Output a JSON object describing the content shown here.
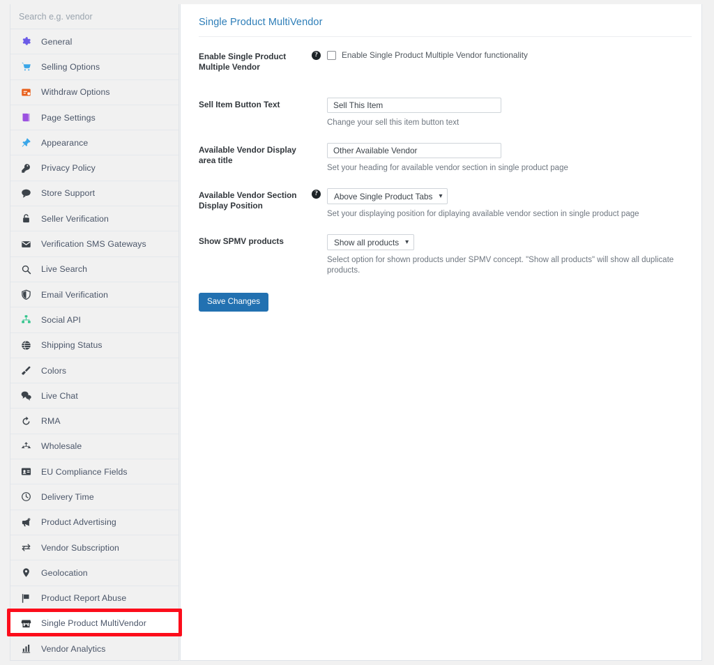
{
  "search": {
    "placeholder": "Search e.g. vendor",
    "value": ""
  },
  "sidebar": {
    "items": [
      {
        "label": "General",
        "icon": "gear-icon",
        "active": false
      },
      {
        "label": "Selling Options",
        "icon": "cart-icon",
        "active": false
      },
      {
        "label": "Withdraw Options",
        "icon": "withdraw-icon",
        "active": false
      },
      {
        "label": "Page Settings",
        "icon": "book-icon",
        "active": false
      },
      {
        "label": "Appearance",
        "icon": "pin-icon",
        "active": false
      },
      {
        "label": "Privacy Policy",
        "icon": "key-icon",
        "active": false
      },
      {
        "label": "Store Support",
        "icon": "chat-bubble-icon",
        "active": false
      },
      {
        "label": "Seller Verification",
        "icon": "lock-icon",
        "active": false
      },
      {
        "label": "Verification SMS Gateways",
        "icon": "envelope-icon",
        "active": false
      },
      {
        "label": "Live Search",
        "icon": "magnifier-icon",
        "active": false
      },
      {
        "label": "Email Verification",
        "icon": "shield-icon",
        "active": false
      },
      {
        "label": "Social API",
        "icon": "sitemap-icon",
        "active": false
      },
      {
        "label": "Shipping Status",
        "icon": "globe-icon",
        "active": false
      },
      {
        "label": "Colors",
        "icon": "paintbrush-icon",
        "active": false
      },
      {
        "label": "Live Chat",
        "icon": "chat-dots-icon",
        "active": false
      },
      {
        "label": "RMA",
        "icon": "undo-arrow-icon",
        "active": false
      },
      {
        "label": "Wholesale",
        "icon": "hierarchy-icon",
        "active": false
      },
      {
        "label": "EU Compliance Fields",
        "icon": "id-card-icon",
        "active": false
      },
      {
        "label": "Delivery Time",
        "icon": "clock-icon",
        "active": false
      },
      {
        "label": "Product Advertising",
        "icon": "megaphone-icon",
        "active": false
      },
      {
        "label": "Vendor Subscription",
        "icon": "exchange-icon",
        "active": false
      },
      {
        "label": "Geolocation",
        "icon": "map-marker-icon",
        "active": false
      },
      {
        "label": "Product Report Abuse",
        "icon": "flag-icon",
        "active": false
      },
      {
        "label": "Single Product MultiVendor",
        "icon": "store-icon",
        "active": true
      },
      {
        "label": "Vendor Analytics",
        "icon": "bar-chart-icon",
        "active": false
      }
    ]
  },
  "content": {
    "title": "Single Product MultiVendor",
    "fields": {
      "enable_spmv": {
        "label": "Enable Single Product Multiple Vendor",
        "checkbox_label": "Enable Single Product Multiple Vendor functionality",
        "checked": false,
        "has_help": true
      },
      "sell_item_button_text": {
        "label": "Sell Item Button Text",
        "value": "Sell This Item",
        "helper": "Change your sell this item button text",
        "has_help": false
      },
      "vendor_display_area_title": {
        "label": "Available Vendor Display area title",
        "value": "Other Available Vendor",
        "helper": "Set your heading for available vendor section in single product page",
        "has_help": false
      },
      "vendor_section_position": {
        "label": "Available Vendor Section Display Position",
        "value": "Above Single Product Tabs",
        "helper": "Set your displaying position for diplaying available vendor section in single product page",
        "has_help": true
      },
      "show_spmv_products": {
        "label": "Show SPMV products",
        "value": "Show all products",
        "helper": "Select option for shown products under SPMV concept. \"Show all products\" will show all duplicate products.",
        "has_help": false
      }
    },
    "save_button": "Save Changes"
  },
  "colors": {
    "title_blue": "#2e7eb8",
    "button_blue": "#2271b1",
    "highlight_red": "#fc0d1b",
    "sidebar_bg": "#f1f1f1"
  }
}
